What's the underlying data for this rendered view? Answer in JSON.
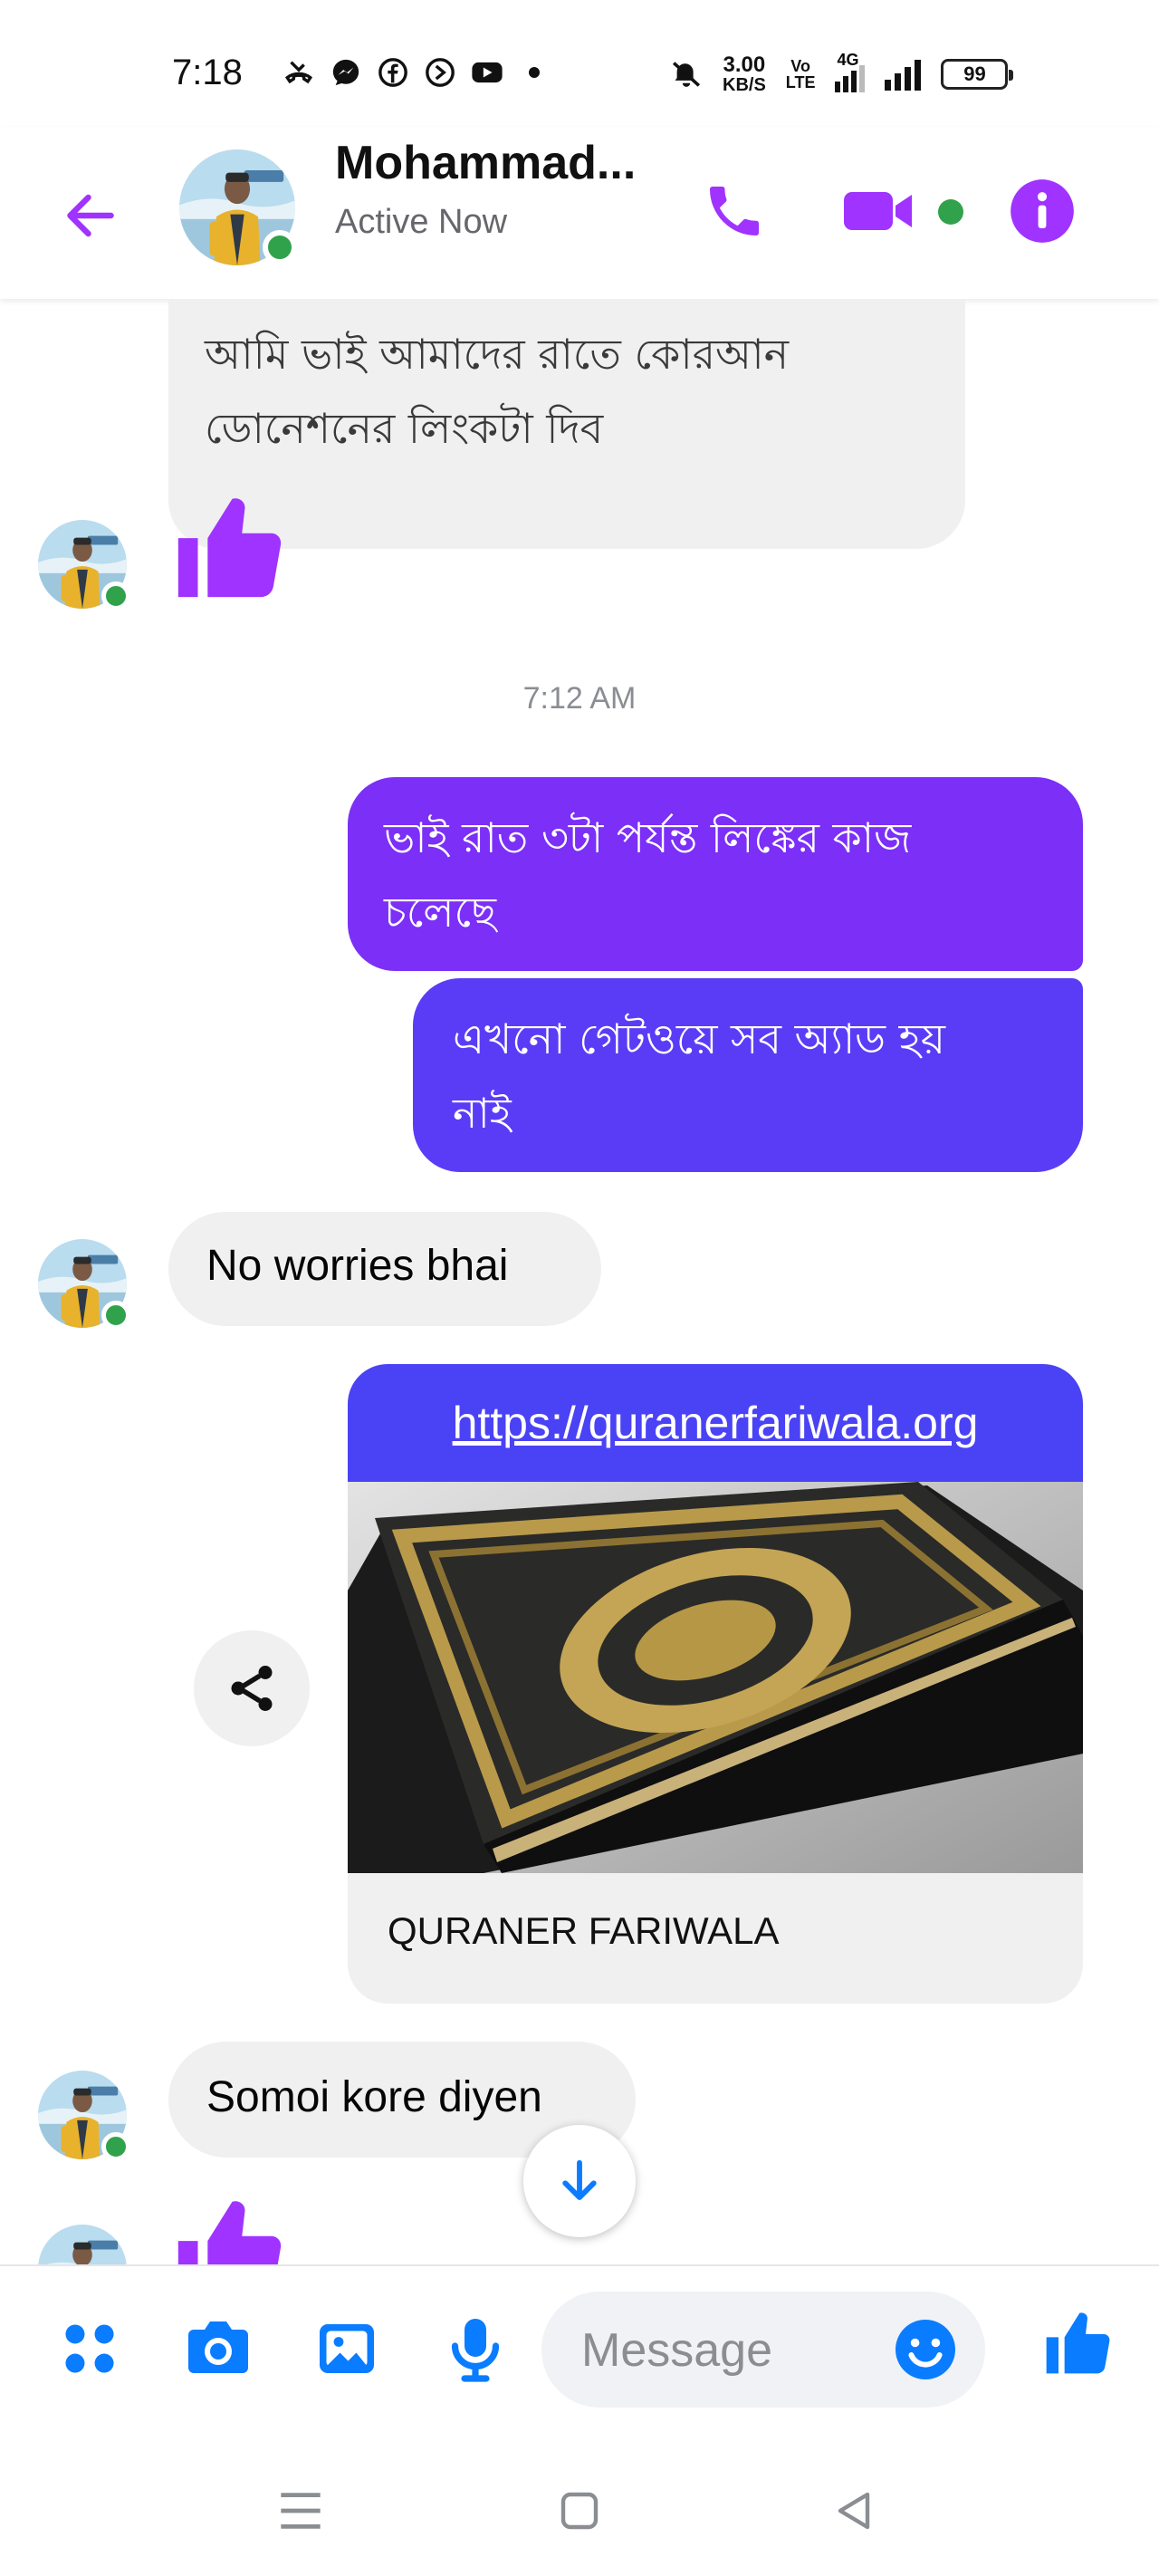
{
  "status_bar": {
    "time": "7:18",
    "net_speed_value": "3.00",
    "net_speed_unit": "KB/S",
    "volte_top": "Vo",
    "volte_bottom": "LTE",
    "network_type": "4G",
    "battery": "99"
  },
  "header": {
    "contact_name": "Mohammad...",
    "status": "Active Now",
    "accent_color": "#a033ff"
  },
  "messages": {
    "msg1": {
      "line1": "আমি ভাই আমাদের রাতে কোরআন",
      "line2": "ডোনেশনের লিংকটা দিব"
    },
    "timestamp": "7:12 AM",
    "msg2": {
      "line1": "ভাই রাত ৩টা পর্যন্ত লিঙ্কের কাজ",
      "line2": "চলেছে"
    },
    "msg3": {
      "line1": "এখনো গেটওয়ে সব অ্যাড হয়",
      "line2": "নাই"
    },
    "msg4": "No worries bhai",
    "link_preview": {
      "url": "https://quranerfariwala.org",
      "title": "QURANER FARIWALA"
    },
    "msg5": "Somoi kore diyen"
  },
  "composer": {
    "placeholder": "Message",
    "accent_color": "#0a7cff"
  },
  "colors": {
    "outgoing_top": "#7b2ff7",
    "outgoing_bottom": "#5b3cf6",
    "incoming_bg": "#f0f0f0",
    "online": "#31a24c"
  }
}
